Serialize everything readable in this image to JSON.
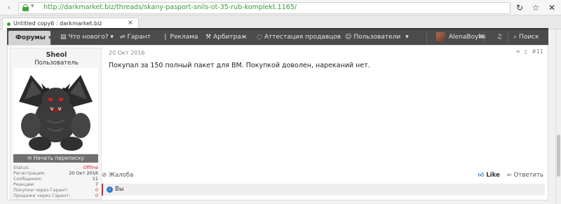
{
  "browser": {
    "url": "http://darkmarket.biz/threads/skany-pasport-snils-ot-35-rub-komplekt.1165/",
    "tab_title": "Untitled copy6 : darkmarket.biz",
    "tab_close": "×"
  },
  "nav": {
    "forums": "Форумы",
    "whats_new": "Что нового?",
    "guarantee": "Гарант",
    "ads": "Реклама",
    "arbitration": "Арбитраж",
    "seller_cert": "Аттестация продавцов",
    "users": "Пользователи",
    "current_user": "AlenaBoyko",
    "search": "Поиск"
  },
  "post": {
    "author": {
      "name": "Sheol",
      "title": "Пользователь",
      "pm_button": "Начать переписку",
      "stats": [
        {
          "label": "Status:",
          "value": "Offline",
          "color": "#dd2222"
        },
        {
          "label": "Регистрация:",
          "value": "20 Окт 2016"
        },
        {
          "label": "Сообщения:",
          "value": "11"
        },
        {
          "label": "Реакции:",
          "value": "7"
        },
        {
          "label": "Покупки через Гарант:",
          "value": "0",
          "color": "#dd2222"
        },
        {
          "label": "Продажи через Гарант:",
          "value": "0",
          "color": "#dd2222"
        }
      ]
    },
    "date": "20 Окт 2016",
    "number": "#11",
    "text": "Покупал за 150 полный пакет для ВМ. Покупкой доволен, нареканий нет.",
    "report": "Жалоба",
    "like": "Like",
    "reply": "Ответить",
    "reactions_text": "Вы"
  }
}
